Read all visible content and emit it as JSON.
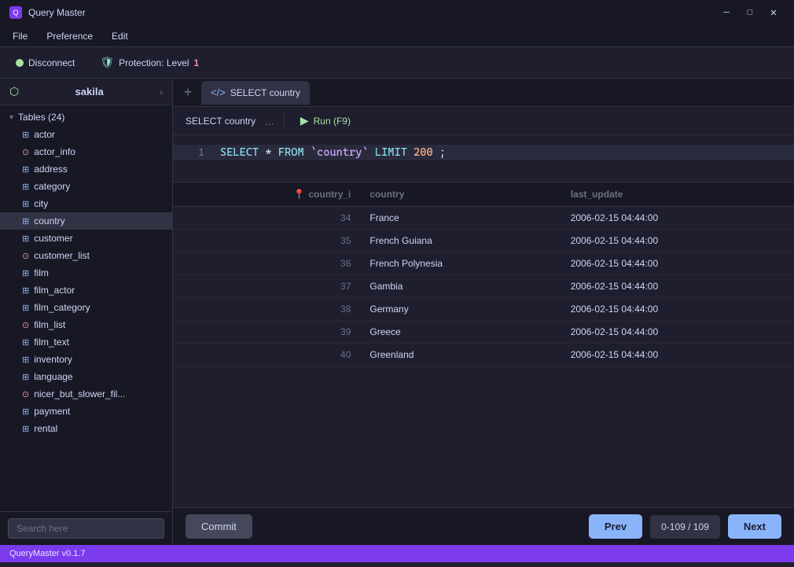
{
  "titlebar": {
    "app_name": "Query Master",
    "min_label": "─",
    "max_label": "□",
    "close_label": "✕"
  },
  "menubar": {
    "items": [
      "File",
      "Preference",
      "Edit"
    ]
  },
  "toolbar": {
    "disconnect_label": "Disconnect",
    "protection_label": "Protection: Level",
    "protection_level": "1"
  },
  "sidebar": {
    "db_name": "sakila",
    "tables_header": "Tables (24)",
    "items": [
      {
        "label": "actor",
        "type": "table"
      },
      {
        "label": "actor_info",
        "type": "view"
      },
      {
        "label": "address",
        "type": "table"
      },
      {
        "label": "category",
        "type": "table"
      },
      {
        "label": "city",
        "type": "table"
      },
      {
        "label": "country",
        "type": "table",
        "active": true
      },
      {
        "label": "customer",
        "type": "table"
      },
      {
        "label": "customer_list",
        "type": "view"
      },
      {
        "label": "film",
        "type": "table"
      },
      {
        "label": "film_actor",
        "type": "table"
      },
      {
        "label": "film_category",
        "type": "table"
      },
      {
        "label": "film_list",
        "type": "view"
      },
      {
        "label": "film_text",
        "type": "table"
      },
      {
        "label": "inventory",
        "type": "table"
      },
      {
        "label": "language",
        "type": "table"
      },
      {
        "label": "nicer_but_slower_fil...",
        "type": "view"
      },
      {
        "label": "payment",
        "type": "table"
      },
      {
        "label": "rental",
        "type": "table"
      }
    ],
    "search_placeholder": "Search here"
  },
  "tabs": {
    "add_label": "+",
    "active_tab": "SELECT country"
  },
  "editor": {
    "tab_label": "SELECT country",
    "tab_dots": "...",
    "run_label": "Run (F9)",
    "code_line": "SELECT * FROM `country` LIMIT 200;"
  },
  "results": {
    "columns": [
      {
        "label": "country_i",
        "icon": "📍"
      },
      {
        "label": "country",
        "icon": ""
      },
      {
        "label": "last_update",
        "icon": ""
      }
    ],
    "rows": [
      {
        "id": "34",
        "country": "France",
        "last_update": "2006-02-15 04:44:00"
      },
      {
        "id": "35",
        "country": "French Guiana",
        "last_update": "2006-02-15 04:44:00"
      },
      {
        "id": "36",
        "country": "French Polynesia",
        "last_update": "2006-02-15 04:44:00"
      },
      {
        "id": "37",
        "country": "Gambia",
        "last_update": "2006-02-15 04:44:00"
      },
      {
        "id": "38",
        "country": "Germany",
        "last_update": "2006-02-15 04:44:00"
      },
      {
        "id": "39",
        "country": "Greece",
        "last_update": "2006-02-15 04:44:00"
      },
      {
        "id": "40",
        "country": "Greenland",
        "last_update": "2006-02-15 04:44:00"
      }
    ]
  },
  "bottombar": {
    "commit_label": "Commit",
    "prev_label": "Prev",
    "page_info": "0-109 / 109",
    "next_label": "Next"
  },
  "statusbar": {
    "version": "QueryMaster v0.1.7"
  }
}
